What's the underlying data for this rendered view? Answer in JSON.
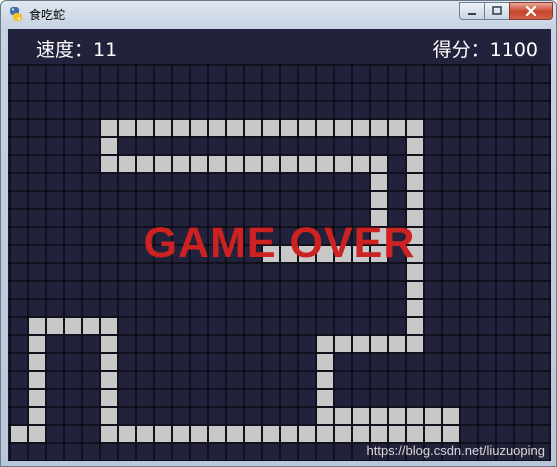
{
  "window": {
    "title": "食吃蛇",
    "icon": "python-snake-icon"
  },
  "hud": {
    "speed_label": "速度：",
    "speed_value": "11",
    "score_label": "得分：",
    "score_value": "1100"
  },
  "overlay": {
    "message": "GAME OVER"
  },
  "watermark": "https://blog.csdn.net/liuzuoping",
  "board": {
    "columns": 30,
    "rows": 22,
    "colors": {
      "background": "#23223c",
      "grid_line": "#000000",
      "snake": "#c8c8c8",
      "game_over": "#cc2222"
    },
    "snake_path": [
      [
        0,
        20
      ],
      [
        1,
        20
      ],
      [
        1,
        14
      ],
      [
        5,
        14
      ],
      [
        5,
        20
      ],
      [
        24,
        20
      ],
      [
        24,
        19
      ],
      [
        17,
        19
      ],
      [
        17,
        15
      ],
      [
        22,
        15
      ],
      [
        22,
        3
      ],
      [
        5,
        3
      ],
      [
        5,
        5
      ],
      [
        20,
        5
      ],
      [
        20,
        10
      ],
      [
        14,
        10
      ]
    ]
  }
}
